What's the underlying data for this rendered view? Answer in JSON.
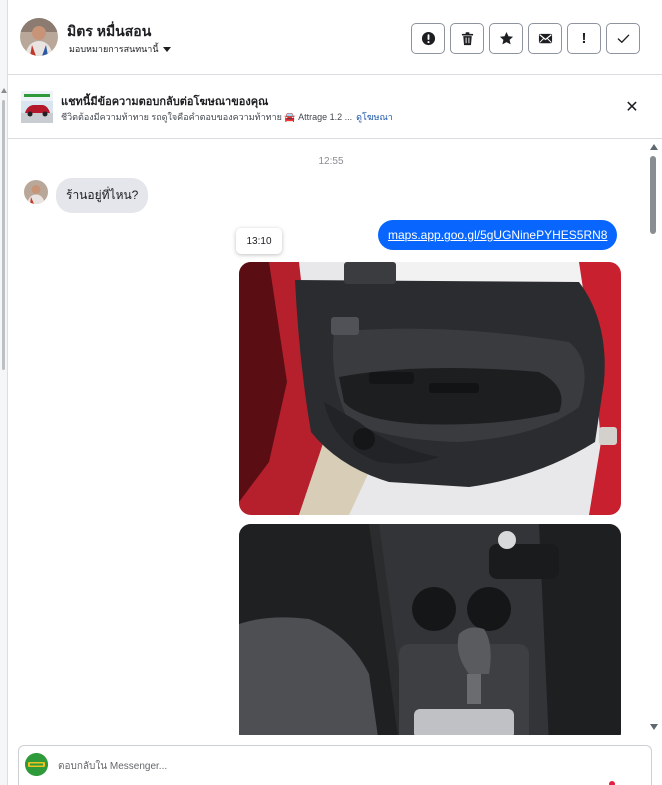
{
  "header": {
    "contact_name": "มิตร หมื่นสอน",
    "assign_label": "มอบหมายการสนทนานี้",
    "actions": [
      {
        "name": "mark-spam-button",
        "icon": "alert-circle-icon"
      },
      {
        "name": "delete-button",
        "icon": "trash-icon"
      },
      {
        "name": "star-button",
        "icon": "star-icon"
      },
      {
        "name": "mark-unread-button",
        "icon": "envelope-icon"
      },
      {
        "name": "follow-up-button",
        "icon": "exclamation-icon"
      },
      {
        "name": "mark-done-button",
        "icon": "check-icon"
      }
    ]
  },
  "ad": {
    "title": "แชทนี้มีข้อความตอบกลับต่อโฆษณาของคุณ",
    "subtitle": "ชีวิตต้องมีความท้าทาย รถดูใจคือคำตอบของความท้าทาย 🚘 Attrage 1.2 ...",
    "view_ad_label": "ดูโฆษณา",
    "close_icon": "close-icon"
  },
  "conversation": {
    "timestamp_1": "12:55",
    "incoming_message": "ร้านอยู่ที่ไหน?",
    "timestamp_hover": "13:10",
    "outgoing_link": "maps.app.goo.gl/5gUGNinePYHES5RN8"
  },
  "composer": {
    "placeholder": "ตอบกลับใน Messenger..."
  },
  "colors": {
    "accent_blue": "#0866ff",
    "bubble_gray": "#e4e6eb",
    "link_blue": "#1a56a8"
  }
}
